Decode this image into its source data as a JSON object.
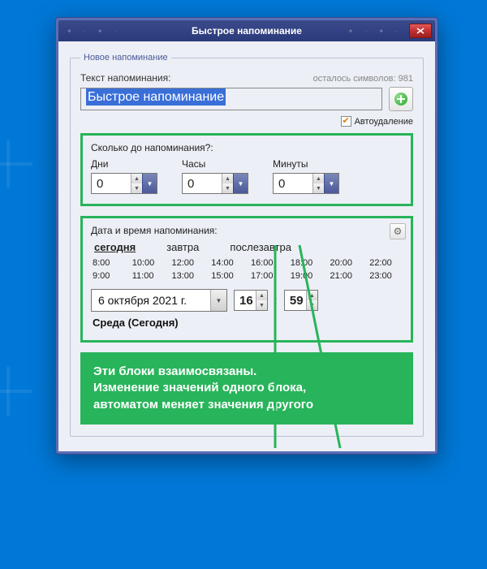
{
  "window": {
    "title": "Быстрое напоминание"
  },
  "fieldset_legend": "Новое напоминание",
  "text_label": "Текст напоминания:",
  "chars_left": "осталось символов: 981",
  "reminder_text": "Быстрое напоминание",
  "autodelete_label": "Автоудаление",
  "duration": {
    "title": "Сколько до напоминания?:",
    "days_label": "Дни",
    "hours_label": "Часы",
    "minutes_label": "Минуты",
    "days": "0",
    "hours": "0",
    "minutes": "0"
  },
  "datetime": {
    "title": "Дата и время напоминания:",
    "tabs": {
      "today": "сегодня",
      "tomorrow": "завтра",
      "day_after": "послезавтра"
    },
    "times": [
      "8:00",
      "10:00",
      "12:00",
      "14:00",
      "16:00",
      "18:00",
      "20:00",
      "22:00",
      "9:00",
      "11:00",
      "13:00",
      "15:00",
      "17:00",
      "19:00",
      "21:00",
      "23:00"
    ],
    "date": "6 октября 2021 г.",
    "hour": "16",
    "minute": "59",
    "colon": ":",
    "weekday": "Среда (Сегодня)"
  },
  "callout": {
    "l1": "Эти блоки взаимосвязаны.",
    "l2": "Изменение значений одного блока,",
    "l3": "автоматом меняет значения другого"
  }
}
